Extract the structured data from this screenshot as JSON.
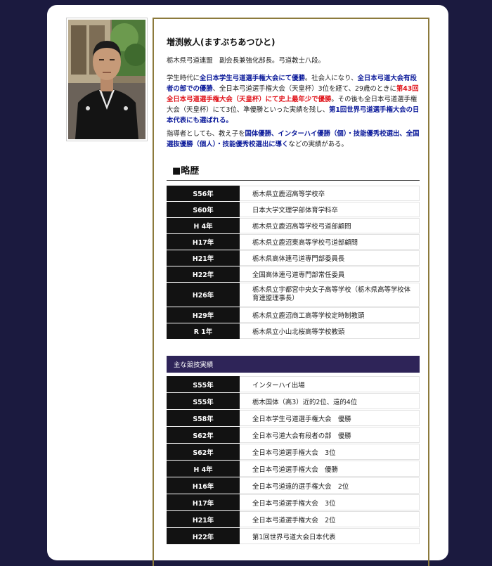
{
  "profile": {
    "name": "増渕敦人(ますぶちあつひと)",
    "title": "栃木県弓道連盟　副会長兼強化部長。弓道教士八段。"
  },
  "para1": {
    "s1": "学生時代に",
    "b1": "全日本学生弓道選手権大会にて優勝",
    "s2": "。社会人になり、",
    "b2": "全日本弓道大会有段者の部での優勝",
    "s3": "、全日本弓道選手権大会（天皇杯）3位を経て、29歳のときに",
    "r1": "第43回全日本弓道選手権大会（天皇杯）にて史上最年少で優勝",
    "s4": "。その後も全日本弓道選手権大会（天皇杯）にて3位、準優勝といった実績を残し、",
    "b3": "第1回世界弓道選手権大会の日本代表にも選ばれる。"
  },
  "para2": {
    "s1": "指導者としても、教え子を",
    "b1": "国体優勝、インターハイ優勝（個）・技能優秀校選出、全国選抜優勝（個人）・技能優秀校選出に導く",
    "s2": "などの実績がある。"
  },
  "career": {
    "heading": "■略歴",
    "rows": [
      {
        "year": "S56年",
        "text": "栃木県立鹿沼高等学校卒"
      },
      {
        "year": "S60年",
        "text": "日本大学文理学部体育学科卒"
      },
      {
        "year": "H 4年",
        "text": "栃木県立鹿沼高等学校弓道部顧問"
      },
      {
        "year": "H17年",
        "text": "栃木県立鹿沼東高等学校弓道部顧問"
      },
      {
        "year": "H21年",
        "text": "栃木県高体連弓道専門部委員長"
      },
      {
        "year": "H22年",
        "text": "全国高体連弓道専門部常任委員"
      },
      {
        "year": "H26年",
        "text": "栃木県立宇都宮中央女子高等学校（栃木県高等学校体育連盟理事長）"
      },
      {
        "year": "H29年",
        "text": "栃木県立鹿沼商工高等学校定時制教頭"
      },
      {
        "year": "R 1年",
        "text": "栃木県立小山北桜高等学校教頭"
      }
    ]
  },
  "results": {
    "heading": "主な競技実績",
    "rows": [
      {
        "year": "S55年",
        "text": "インターハイ出場"
      },
      {
        "year": "S55年",
        "text": "栃木国体（高3）近的2位、遠的4位"
      },
      {
        "year": "S58年",
        "text": "全日本学生弓道選手権大会　優勝"
      },
      {
        "year": "S62年",
        "text": "全日本弓道大会有段者の部　優勝"
      },
      {
        "year": "S62年",
        "text": "全日本弓道選手権大会　3位"
      },
      {
        "year": "H 4年",
        "text": "全日本弓道選手権大会　優勝"
      },
      {
        "year": "H16年",
        "text": "全日本弓道遠的選手権大会　2位"
      },
      {
        "year": "H17年",
        "text": "全日本弓道選手権大会　3位"
      },
      {
        "year": "H21年",
        "text": "全日本弓道選手権大会　2位"
      },
      {
        "year": "H22年",
        "text": "第1回世界弓道大会日本代表"
      }
    ]
  }
}
